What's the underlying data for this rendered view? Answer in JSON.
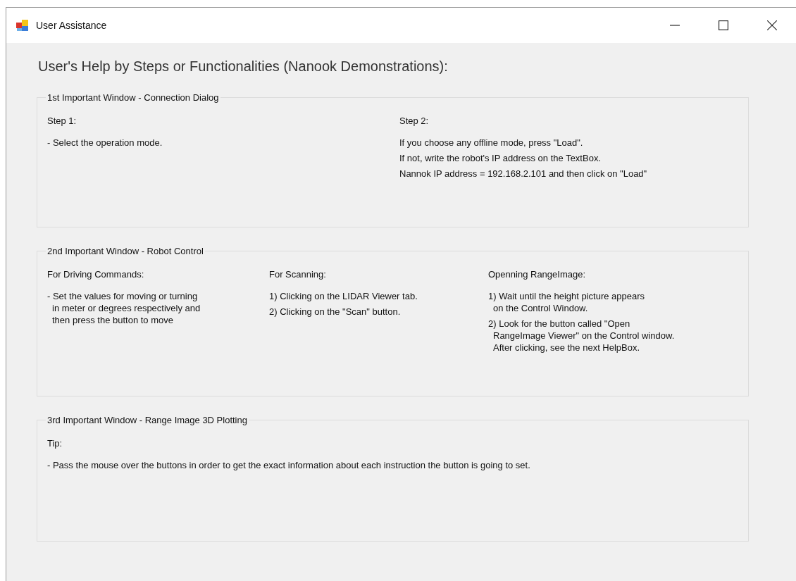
{
  "window": {
    "title": "User Assistance"
  },
  "heading": "User's Help by Steps or Functionalities (Nanook Demonstrations):",
  "groups": [
    {
      "title": "1st Important Window - Connection Dialog",
      "columns": [
        {
          "label": "Step 1:",
          "paragraphs": [
            [
              "- Select the operation mode."
            ]
          ]
        },
        {
          "label": "Step 2:",
          "paragraphs": [
            [
              "If you choose any offline mode, press \"Load\"."
            ],
            [
              "If not, write the robot's IP address on the TextBox."
            ],
            [
              "Nannok IP address = 192.168.2.101 and then click on \"Load\""
            ]
          ]
        }
      ]
    },
    {
      "title": "2nd Important Window - Robot Control",
      "columns": [
        {
          "label": "For Driving Commands:",
          "paragraphs": [
            [
              "- Set the values for moving or turning",
              "in meter or degrees respectively and",
              "then press the button to move"
            ]
          ]
        },
        {
          "label": "For Scanning:",
          "paragraphs": [
            [
              "1) Clicking on the LIDAR Viewer tab."
            ],
            [
              "2) Clicking on the \"Scan\" button."
            ]
          ]
        },
        {
          "label": "Openning RangeImage:",
          "paragraphs": [
            [
              "1) Wait until the height picture appears",
              "on the Control Window."
            ],
            [
              "2) Look for the button called \"Open",
              "RangeImage Viewer\" on the Control window.",
              "After clicking,  see the next HelpBox."
            ]
          ]
        }
      ]
    },
    {
      "title": "3rd Important Window - Range Image 3D Plotting",
      "columns": [
        {
          "label": "Tip:",
          "paragraphs": [
            [
              "- Pass the mouse over the buttons in order to get the exact information about each instruction the button is going to set."
            ]
          ]
        }
      ]
    }
  ]
}
